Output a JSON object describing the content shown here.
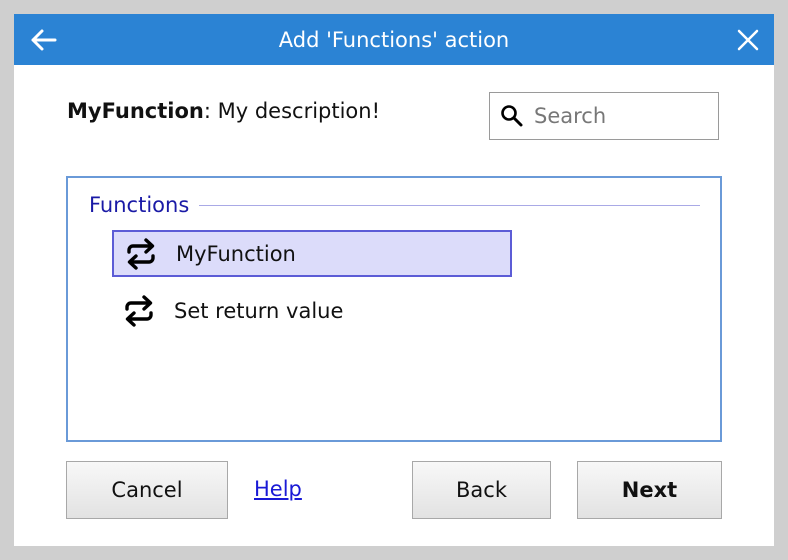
{
  "dialog": {
    "title": "Add 'Functions' action",
    "back_icon": "arrow-left-icon",
    "close_icon": "close-icon"
  },
  "description": {
    "name": "MyFunction",
    "text": ": My description!"
  },
  "search": {
    "placeholder": "Search",
    "value": "",
    "icon": "search-icon"
  },
  "list": {
    "group_label": "Functions",
    "items": [
      {
        "label": "MyFunction",
        "icon": "repeat-arrows-icon",
        "selected": true
      },
      {
        "label": "Set return value",
        "icon": "repeat-arrows-icon",
        "selected": false
      }
    ]
  },
  "buttons": {
    "cancel": "Cancel",
    "help": "Help",
    "back": "Back",
    "next": "Next"
  },
  "colors": {
    "titlebar": "#2b83d4",
    "selection_bg": "#dcdcfa",
    "selection_border": "#5c5cd6",
    "group_label": "#1a1aa6"
  }
}
